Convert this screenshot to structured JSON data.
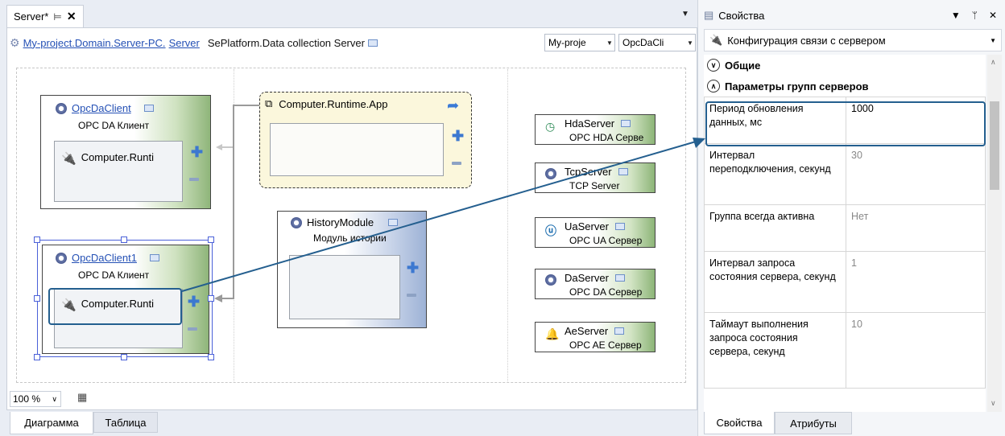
{
  "document_tab": {
    "title": "Server",
    "modified_mark": "*",
    "pin": "⊨",
    "close": "✕"
  },
  "address": {
    "path_link": "My-project.Domain.Server-PC.",
    "server_link": "Server",
    "description": "SePlatform.Data collection Server",
    "project_select": "My-proje",
    "type_select": "OpcDaCli"
  },
  "diagram": {
    "client1": {
      "name": "OpcDaClient",
      "subtitle": "OPC DA Клиент",
      "connection": "Computer.Runti"
    },
    "app": {
      "name": "Computer.Runtime.App"
    },
    "client2": {
      "name": "OpcDaClient1",
      "subtitle": "OPC DA Клиент",
      "connection": "Computer.Runti"
    },
    "history": {
      "name": "HistoryModule",
      "subtitle": "Модуль истории"
    },
    "servers": [
      {
        "name": "HdaServer",
        "subtitle": "OPC HDA Серве",
        "icon": "clock-icon"
      },
      {
        "name": "TcpServer",
        "subtitle": "TCP Server",
        "icon": "gear-icon"
      },
      {
        "name": "UaServer",
        "subtitle": "OPC UA Сервер",
        "icon": "ua-icon"
      },
      {
        "name": "DaServer",
        "subtitle": "OPC DA Сервер",
        "icon": "gear-icon"
      },
      {
        "name": "AeServer",
        "subtitle": "OPC AE Сервер",
        "icon": "bell-icon"
      }
    ]
  },
  "bottom": {
    "zoom": "100 %",
    "tabs": [
      "Диаграмма",
      "Таблица"
    ]
  },
  "properties": {
    "title": "Свойства",
    "object": "Конфигурация связи с сервером",
    "categories": [
      "Общие",
      "Параметры групп серверов"
    ],
    "rows": [
      {
        "name": "Период обновления данных, мс",
        "value": "1000"
      },
      {
        "name": "Интервал переподключения, секунд",
        "value": "30"
      },
      {
        "name": "Группа всегда активна",
        "value": "Нет"
      },
      {
        "name": "Интервал запроса состояния сервера, секунд",
        "value": "1"
      },
      {
        "name": "Таймаут выполнения запроса состояния сервера, секунд",
        "value": "10"
      }
    ],
    "tabs": [
      "Свойства",
      "Атрибуты"
    ]
  },
  "colors": {
    "link": "#2450b5",
    "highlight": "#245f8f",
    "node_green": "#8fb57a",
    "history_blue": "#9db2d6"
  }
}
